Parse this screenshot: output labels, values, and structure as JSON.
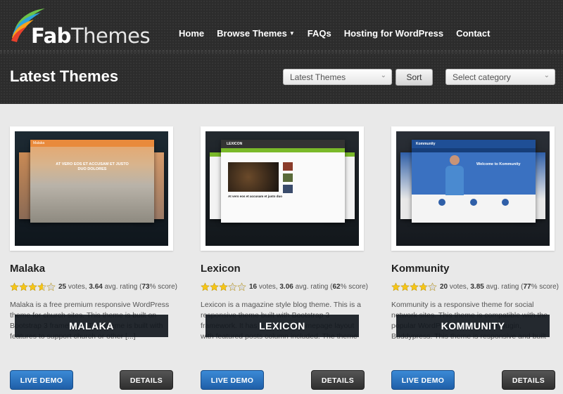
{
  "logo": {
    "fab": "Fab",
    "themes": "Themes"
  },
  "nav": {
    "home": "Home",
    "browse": "Browse Themes",
    "faqs": "FAQs",
    "hosting": "Hosting for WordPress",
    "contact": "Contact"
  },
  "page": {
    "title": "Latest Themes",
    "sort_select": "Latest Themes",
    "sort_button": "Sort",
    "category_select": "Select category"
  },
  "cards": [
    {
      "banner": "MALAKA",
      "title": "Malaka",
      "stars": 3.64,
      "votes": "25",
      "votes_label": "votes,",
      "avg": "3.64",
      "avg_label": "avg. rating (",
      "score": "73",
      "score_label": "% score)",
      "desc": "Malaka is a free premium responsive WordPress theme for church sites. This theme is built on Bootstrap 3 framework. This theme is built with features to support church or other [...]",
      "demo": "LIVE DEMO",
      "details": "DETAILS",
      "shot_heading": "AT VERO EOS ET ACCUSAM ET JUSTO DUO DOLORES",
      "shot_brand": "Malaka"
    },
    {
      "banner": "LEXICON",
      "title": "Lexicon",
      "stars": 3.06,
      "votes": "16",
      "votes_label": "votes,",
      "avg": "3.06",
      "avg_label": "avg. rating (",
      "score": "62",
      "score_label": "% score)",
      "desc": "Lexicon is a magazine style blog theme. This is a responsive theme built with Bootstrap 3 framework. It has a 3 column homepage layout with featured posts column included. The theme [...]",
      "demo": "LIVE DEMO",
      "details": "DETAILS",
      "shot_brand": "LEXICON",
      "shot_caption": "At vero eos et accusam et justo duo"
    },
    {
      "banner": "KOMMUNITY",
      "title": "Kommunity",
      "stars": 3.85,
      "votes": "20",
      "votes_label": "votes,",
      "avg": "3.85",
      "avg_label": "avg. rating (",
      "score": "77",
      "score_label": "% score)",
      "desc": "Kommunity is a responsive theme for social network sites. This theme is compatible with the popular WordPress social media plugin, Buddypress. This theme is responsive and built on bootstrap framework. [...]",
      "demo": "LIVE DEMO",
      "details": "DETAILS",
      "shot_brand": "Kommunity",
      "shot_heading": "Welcome to Kommunity"
    }
  ],
  "colors": {
    "header_bg": "#2c2c2c",
    "demo_button": "#2a72bd",
    "details_button": "#3f3f3f",
    "star": "#f5c518"
  }
}
